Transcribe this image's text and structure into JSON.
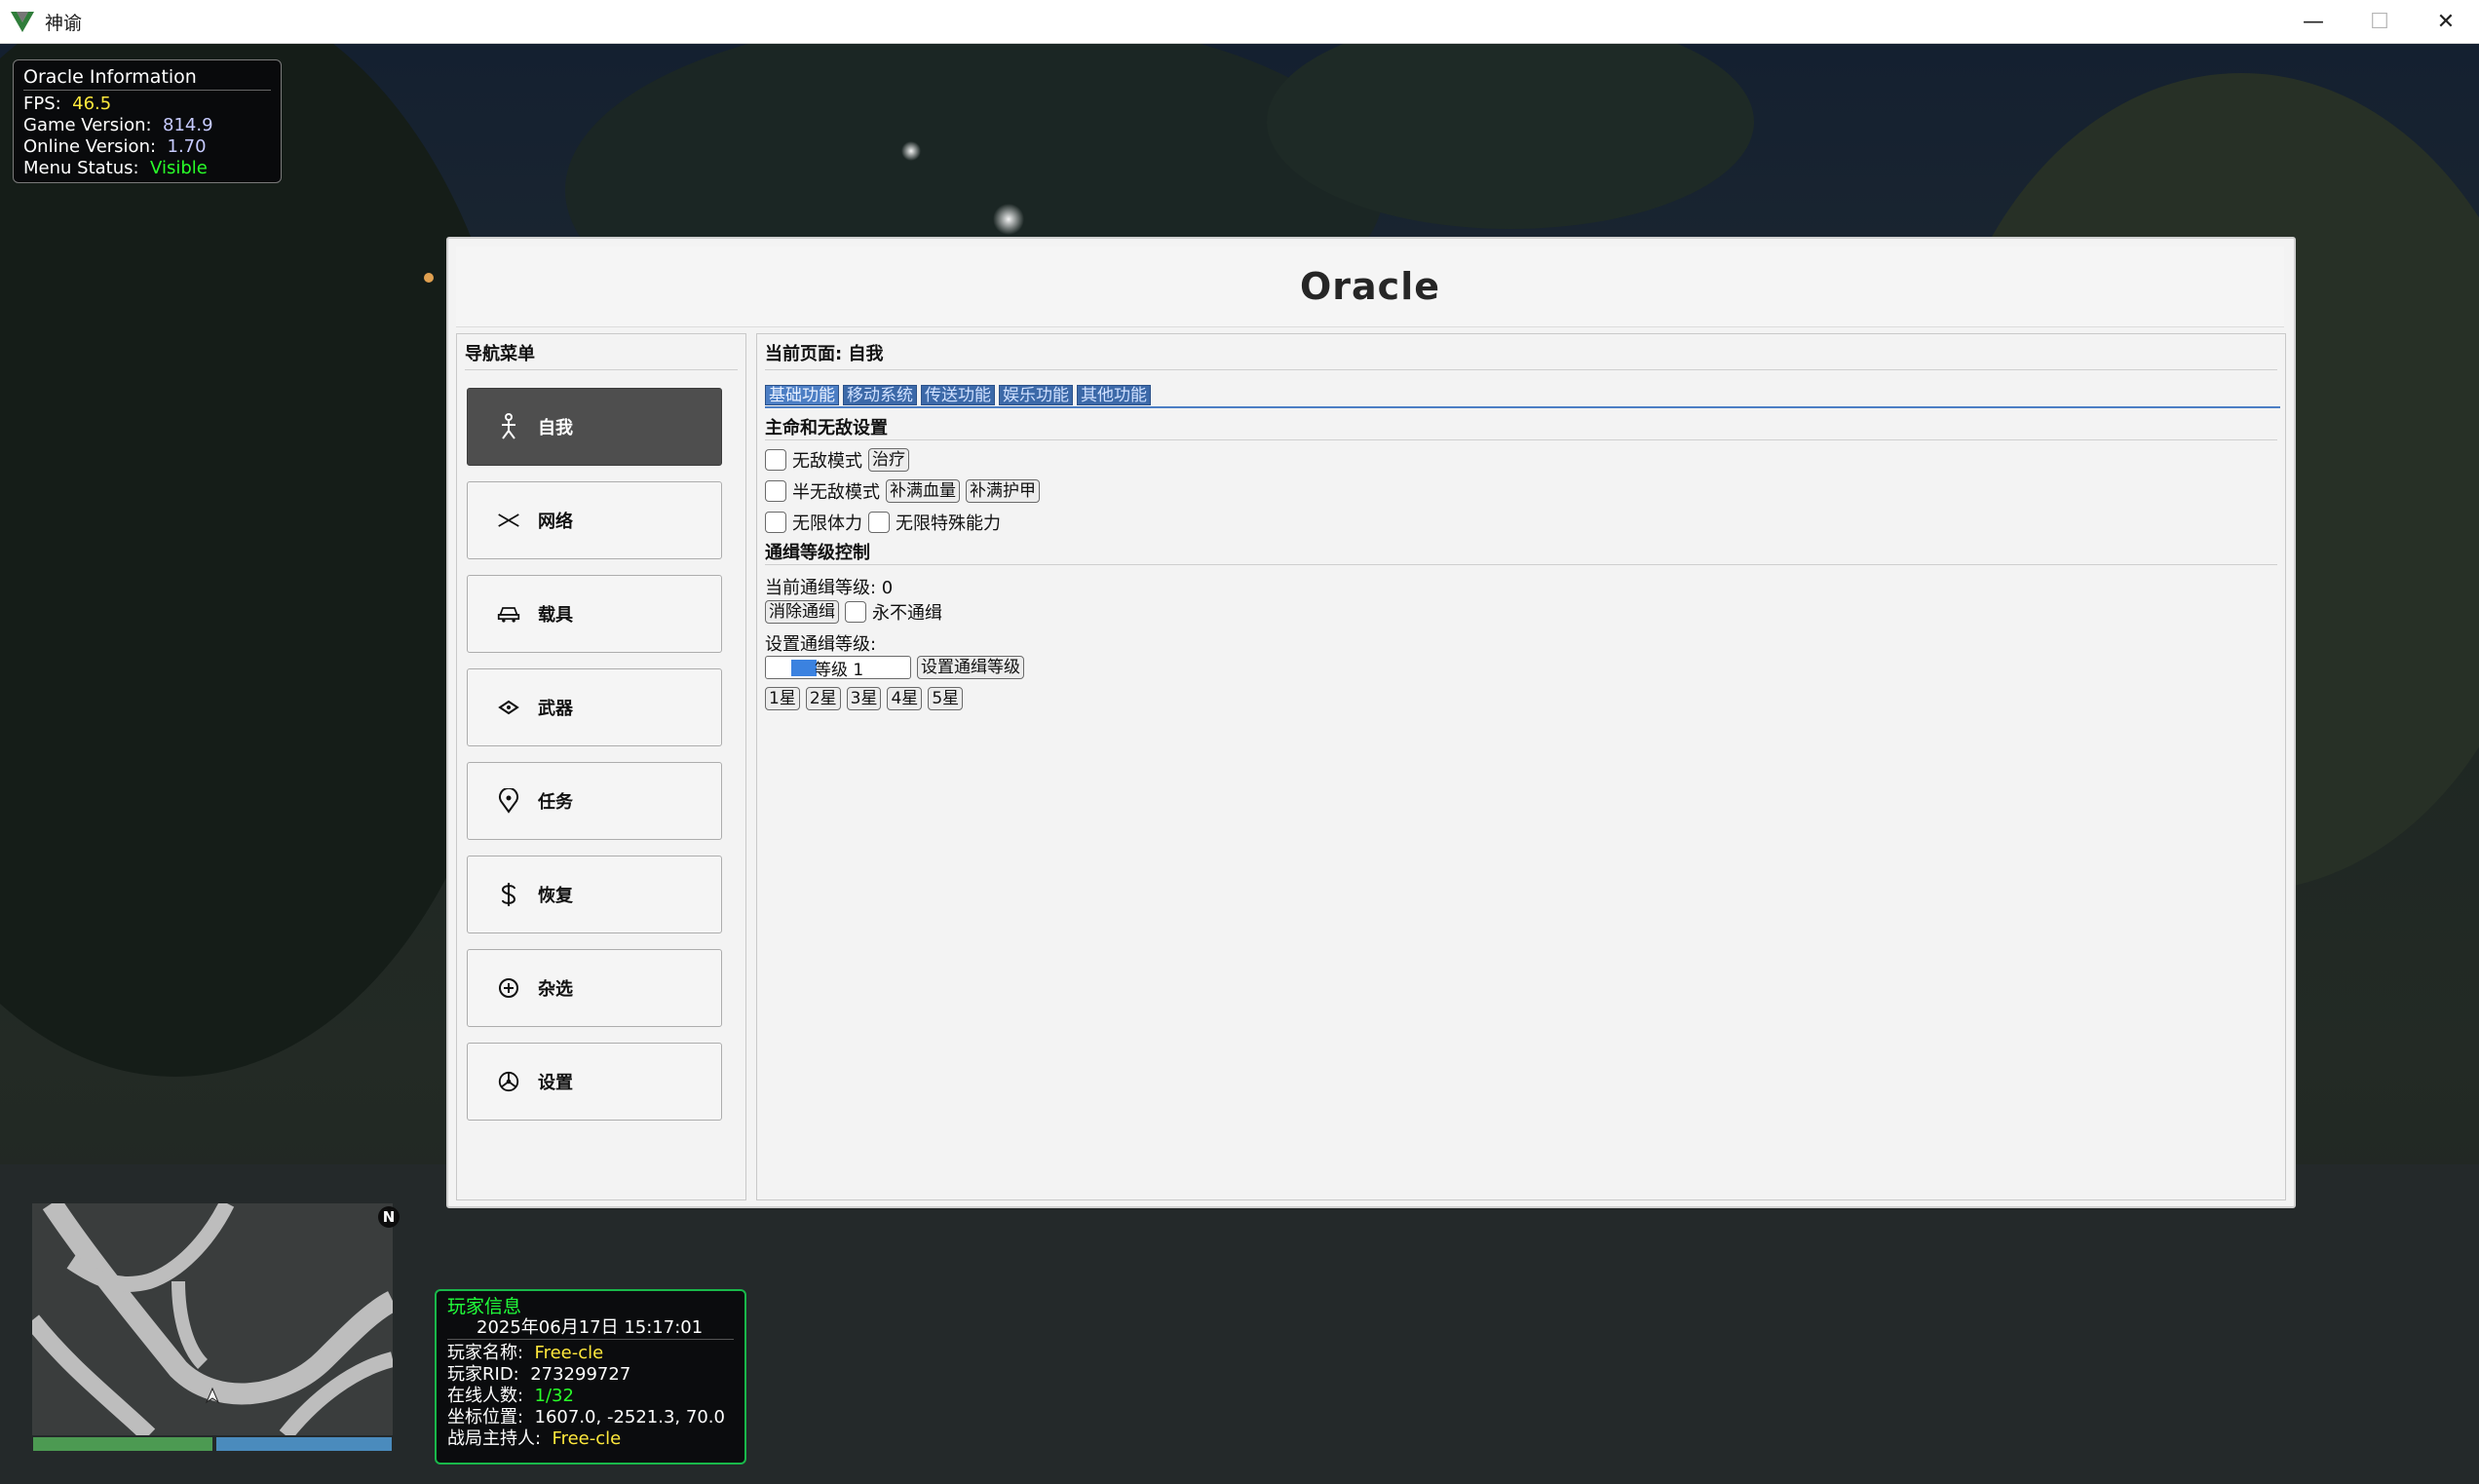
{
  "window": {
    "title": "神谕",
    "controls": {
      "minimize": "—",
      "maximize": "☐",
      "close": "✕"
    }
  },
  "oracle_info": {
    "title": "Oracle Information",
    "fps_label": "FPS:",
    "fps_value": "46.5",
    "game_version_label": "Game Version:",
    "game_version_value": "814.9",
    "online_version_label": "Online Version:",
    "online_version_value": "1.70",
    "menu_status_label": "Menu Status:",
    "menu_status_value": "Visible"
  },
  "menu": {
    "brand": "Oracle",
    "nav": {
      "title": "导航菜单",
      "items": [
        {
          "label": "自我",
          "icon": "person-icon",
          "active": true
        },
        {
          "label": "网络",
          "icon": "network-icon",
          "active": false
        },
        {
          "label": "载具",
          "icon": "car-icon",
          "active": false
        },
        {
          "label": "武器",
          "icon": "weapon-icon",
          "active": false
        },
        {
          "label": "任务",
          "icon": "location-pin-icon",
          "active": false
        },
        {
          "label": "恢复",
          "icon": "dollar-icon",
          "active": false
        },
        {
          "label": "杂选",
          "icon": "plus-circle-icon",
          "active": false
        },
        {
          "label": "设置",
          "icon": "wheel-icon",
          "active": false
        }
      ]
    },
    "content": {
      "current_page": "当前页面: 自我",
      "tabs": [
        "基础功能",
        "移动系统",
        "传送功能",
        "娱乐功能",
        "其他功能"
      ],
      "section_health": {
        "title": "主命和无敌设置",
        "godmode": "无敌模式",
        "heal": "治疗",
        "semi_godmode": "半无敌模式",
        "refill_health": "补满血量",
        "refill_armor": "补满护甲",
        "infinite_stamina": "无限体力",
        "infinite_special": "无限特殊能力"
      },
      "section_wanted": {
        "title": "通缉等级控制",
        "current_level": "当前通缉等级: 0",
        "clear_wanted": "消除通缉",
        "never_wanted": "永不通缉",
        "set_level_label": "设置通缉等级:",
        "level_input": "等级 1",
        "set_level_button": "设置通缉等级",
        "stars": [
          "1星",
          "2星",
          "3星",
          "4星",
          "5星"
        ]
      }
    }
  },
  "player_info": {
    "title": "玩家信息",
    "datetime": "2025年06月17日 15:17:01",
    "name_label": "玩家名称:",
    "name_value": "Free-cle",
    "rid_label": "玩家RID:",
    "rid_value": "273299727",
    "online_label": "在线人数:",
    "online_value": "1/32",
    "coords_label": "坐标位置:",
    "coords_value": "1607.0, -2521.3, 70.0",
    "host_label": "战局主持人:",
    "host_value": "Free-cle"
  },
  "minimap": {
    "north": "N"
  },
  "colors": {
    "accent_tab": "#4c7ec4",
    "active_nav": "#4e4e4e",
    "player_border": "#19b84a",
    "fps": "#ffe83c",
    "status_visible": "#29ff29"
  }
}
